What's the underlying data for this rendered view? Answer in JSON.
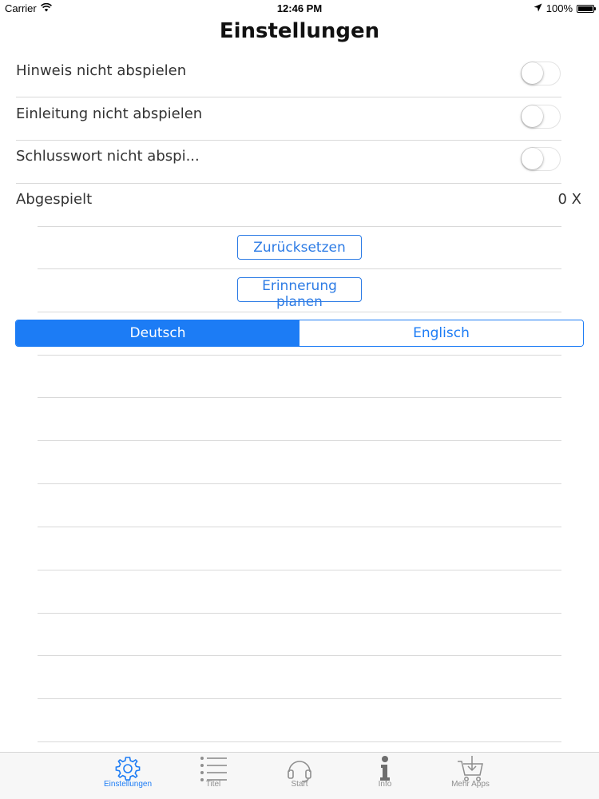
{
  "status_bar": {
    "carrier": "Carrier",
    "time": "12:46 PM",
    "battery": "100%"
  },
  "header": {
    "title": "Einstellungen"
  },
  "settings": {
    "toggles": [
      {
        "label": "Hinweis nicht abspielen",
        "on": false
      },
      {
        "label": "Einleitung nicht abspielen",
        "on": false
      },
      {
        "label": "Schlusswort nicht abspi...",
        "on": false
      }
    ],
    "played": {
      "label": "Abgespielt",
      "value": "0 X"
    },
    "reset_button": "Zurücksetzen",
    "reminder_button": "Erinnerung planen",
    "language": {
      "options": [
        "Deutsch",
        "Englisch"
      ],
      "selected": "Deutsch"
    }
  },
  "tab_bar": {
    "tabs": [
      {
        "label": "Einstellungen",
        "icon": "gear-icon",
        "active": true
      },
      {
        "label": "Titel",
        "icon": "list-icon",
        "active": false
      },
      {
        "label": "Start",
        "icon": "headphones-icon",
        "active": false
      },
      {
        "label": "Info",
        "icon": "info-icon",
        "active": false
      },
      {
        "label": "Mehr Apps",
        "icon": "cart-icon",
        "active": false
      }
    ]
  },
  "colors": {
    "accent": "#1c7cf5",
    "tab_inactive": "#8e8e8e",
    "divider": "#d9d9d9"
  }
}
